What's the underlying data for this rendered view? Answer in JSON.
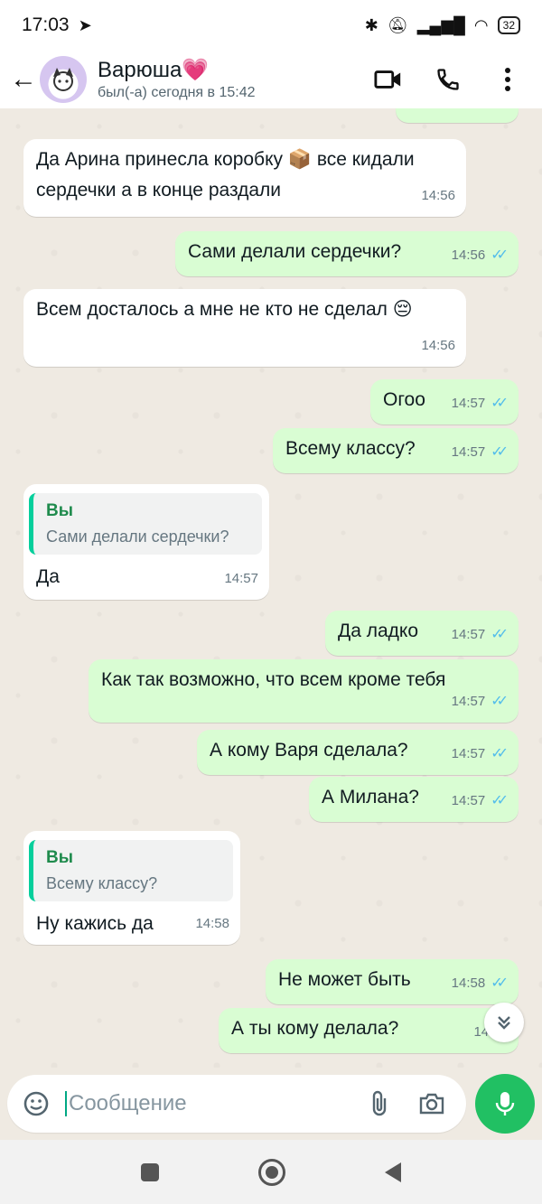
{
  "status": {
    "time": "17:03",
    "battery": "32"
  },
  "contact": {
    "name": "Варюша💗",
    "last_seen": "был(-а) сегодня в 15:42"
  },
  "messages": [
    {
      "dir": "in",
      "text": "Да Арина принесла коробку 📦 все кидали сердечки а в конце раздали",
      "time": "14:56"
    },
    {
      "dir": "out",
      "text": "Сами делали сердечки?",
      "time": "14:56"
    },
    {
      "dir": "in",
      "text": "Всем досталось а мне не кто не сделал 😔",
      "time": "14:56"
    },
    {
      "dir": "out",
      "text": "Огоо",
      "time": "14:57"
    },
    {
      "dir": "out",
      "text": "Всему классу?",
      "time": "14:57"
    },
    {
      "dir": "in",
      "quote_author": "Вы",
      "quote_text": "Сами делали сердечки?",
      "text": "Да",
      "time": "14:57"
    },
    {
      "dir": "out",
      "text": "Да ладко",
      "time": "14:57"
    },
    {
      "dir": "out",
      "text": "Как так возможно, что всем кроме тебя",
      "time": "14:57"
    },
    {
      "dir": "out",
      "text": "А кому Варя сделала?",
      "time": "14:57"
    },
    {
      "dir": "out",
      "text": "А Милана?",
      "time": "14:57"
    },
    {
      "dir": "in",
      "quote_author": "Вы",
      "quote_text": "Всему классу?",
      "text": "Ну кажись да",
      "time": "14:58"
    },
    {
      "dir": "out",
      "text": "Не может быть",
      "time": "14:58"
    },
    {
      "dir": "out",
      "text": "А ты кому делала?",
      "time": "14:58"
    }
  ],
  "composer": {
    "placeholder": "Сообщение"
  },
  "colors": {
    "accent": "#00a884",
    "outgoing": "#d9fdd3",
    "incoming": "#ffffff",
    "read_ticks": "#53bdeb"
  }
}
